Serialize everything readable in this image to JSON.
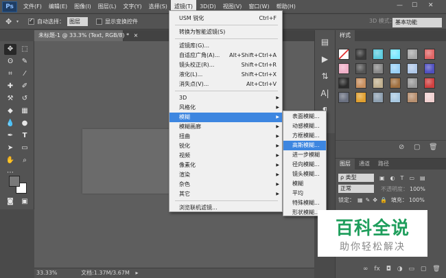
{
  "app": {
    "logo": "Ps"
  },
  "menubar": {
    "items": [
      "文件(F)",
      "编辑(E)",
      "图像(I)",
      "图层(L)",
      "文字(Y)",
      "选择(S)",
      "滤镜(T)",
      "3D(D)",
      "视图(V)",
      "窗口(W)",
      "帮助(H)"
    ],
    "active_index": 6
  },
  "options": {
    "auto_select_label": "自动选择：",
    "auto_select_value": "图层",
    "show_transform_label": "显示变换控件",
    "mode_3d": "3D 模式：",
    "workspace": "基本功能"
  },
  "document": {
    "tab_title": "未标题-1 @ 33.3% (Text, RGB/8) *",
    "zoom": "33.33%",
    "doc_info": "文档:1.37M/3.67M"
  },
  "filter_menu": [
    {
      "label": "USM 锐化",
      "shortcut": "Ctrl+F"
    },
    {
      "type": "sep"
    },
    {
      "label": "转换为智能滤镜(S)"
    },
    {
      "type": "sep"
    },
    {
      "label": "滤镜库(G)..."
    },
    {
      "label": "自适应广角(A)...",
      "shortcut": "Alt+Shift+Ctrl+A"
    },
    {
      "label": "镜头校正(R)...",
      "shortcut": "Shift+Ctrl+R"
    },
    {
      "label": "液化(L)...",
      "shortcut": "Shift+Ctrl+X"
    },
    {
      "label": "消失点(V)...",
      "shortcut": "Alt+Ctrl+V"
    },
    {
      "type": "sep"
    },
    {
      "label": "3D",
      "submenu": true
    },
    {
      "label": "风格化",
      "submenu": true
    },
    {
      "label": "模糊",
      "submenu": true,
      "highlighted": true
    },
    {
      "label": "模糊画廊",
      "submenu": true
    },
    {
      "label": "扭曲",
      "submenu": true
    },
    {
      "label": "锐化",
      "submenu": true
    },
    {
      "label": "视频",
      "submenu": true
    },
    {
      "label": "像素化",
      "submenu": true
    },
    {
      "label": "渲染",
      "submenu": true
    },
    {
      "label": "杂色",
      "submenu": true
    },
    {
      "label": "其它",
      "submenu": true
    },
    {
      "type": "sep"
    },
    {
      "label": "浏览联机滤镜..."
    }
  ],
  "blur_submenu": [
    {
      "label": "表面模糊..."
    },
    {
      "label": "动感模糊..."
    },
    {
      "label": "方框模糊..."
    },
    {
      "label": "高斯模糊...",
      "highlighted": true
    },
    {
      "label": "进一步模糊"
    },
    {
      "label": "径向模糊..."
    },
    {
      "label": "镜头模糊..."
    },
    {
      "label": "模糊"
    },
    {
      "label": "平均"
    },
    {
      "label": "特殊模糊..."
    },
    {
      "label": "形状模糊..."
    }
  ],
  "styles_panel": {
    "tab": "样式",
    "swatches": [
      "#d8d8d8",
      "#3a3a3a",
      "#5ecde0",
      "#7ae8ff",
      "#a8a8a8",
      "#e06666",
      "#f0b0c8",
      "#555555",
      "#888888",
      "#9ad0f5",
      "#b0c8e8",
      "#5050c0",
      "#2b2b2b",
      "#c89060",
      "#c0b090",
      "#a07040",
      "#9a9a9a",
      "#d04040",
      "#6a7080",
      "#e0a030",
      "#8ea0b0",
      "#a8c8e0",
      "#b89070",
      "#f0d0d0"
    ]
  },
  "layers_panel": {
    "tabs": [
      "图层",
      "通道",
      "路径"
    ],
    "kind_label": "ρ 类型",
    "blend_mode": "正常",
    "opacity_label": "不透明度：",
    "opacity_value": "100%",
    "lock_label": "锁定：",
    "fill_label": "填充：",
    "fill_value": "100%"
  },
  "watermark": {
    "title": "百科全说",
    "subtitle": "助你轻松解决"
  }
}
